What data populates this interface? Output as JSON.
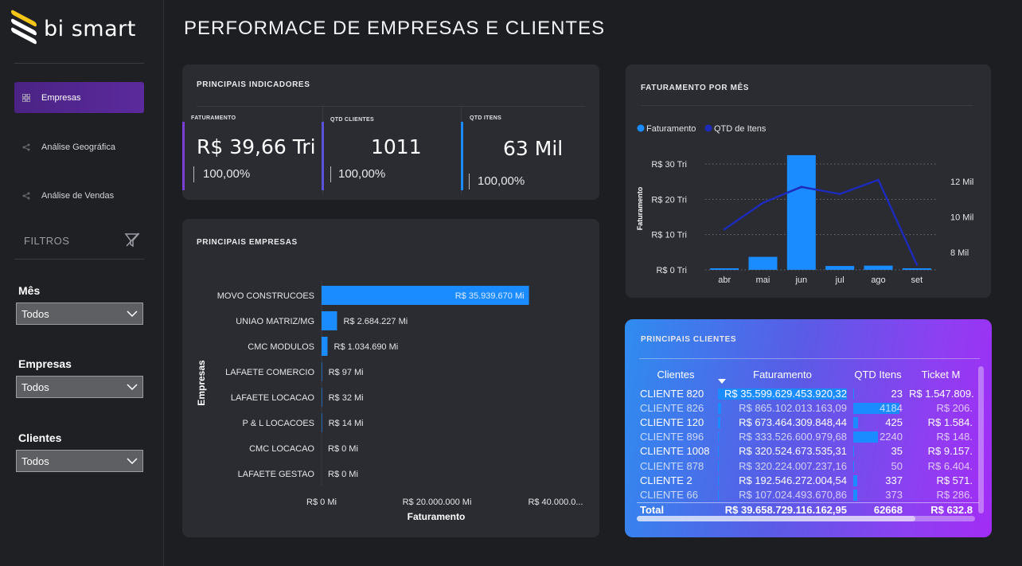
{
  "app": {
    "logo_text": "bi smart"
  },
  "page_title": "PERFORMACE DE EMPRESAS E CLIENTES",
  "nav": [
    {
      "label": "Empresas",
      "active": true,
      "icon": "grid-icon"
    },
    {
      "label": "Análise Geográfica",
      "active": false,
      "icon": "network-icon"
    },
    {
      "label": "Análise de Vendas",
      "active": false,
      "icon": "share-icon"
    }
  ],
  "filters": {
    "title": "FILTROS",
    "items": [
      {
        "label": "Mês",
        "value": "Todos"
      },
      {
        "label": "Empresas",
        "value": "Todos"
      },
      {
        "label": "Clientes",
        "value": "Todos"
      }
    ]
  },
  "kpis": {
    "title": "PRINCIPAIS INDICADORES",
    "items": [
      {
        "label": "FATURAMENTO",
        "value": "R$ 39,66 Tri",
        "pct": "100,00%",
        "color": "#7b3fd6"
      },
      {
        "label": "QTD CLIENTES",
        "value": "1011",
        "pct": "100,00%",
        "color": "#5a52d8"
      },
      {
        "label": "QTD ITENS",
        "value": "63 Mil",
        "pct": "100,00%",
        "color": "#1a8cff"
      }
    ]
  },
  "colors": {
    "accent": "#1a8cff",
    "line": "#1d2bb8",
    "purple": "#5b2a9c"
  },
  "chart_data": [
    {
      "type": "bar",
      "title": "PRINCIPAIS EMPRESAS",
      "orientation": "horizontal",
      "xlabel": "Faturamento",
      "ylabel": "Empresas",
      "categories": [
        "MOVO CONSTRUCOES",
        "UNIAO MATRIZ/MG",
        "CMC MODULOS",
        "LAFAETE COMERCIO",
        "LAFAETE LOCACAO",
        "P & L LOCACOES",
        "CMC LOCACAO",
        "LAFAETE GESTAO"
      ],
      "values": [
        35939670,
        2684227,
        1034690,
        97,
        32,
        14,
        0,
        0
      ],
      "value_labels": [
        "R$ 35.939.670 Mi",
        "R$ 2.684.227 Mi",
        "R$ 1.034.690 Mi",
        "R$ 97 Mi",
        "R$ 32 Mi",
        "R$ 14 Mi",
        "R$ 0 Mi",
        "R$ 0 Mi"
      ],
      "x_ticks": [
        "R$ 0 Mi",
        "R$ 20.000.000 Mi",
        "R$ 40.000.0..."
      ],
      "xlim": [
        0,
        40000000
      ]
    },
    {
      "type": "bar+line",
      "title": "FATURAMENTO POR MÊS",
      "legend": [
        "Faturamento",
        "QTD de Itens"
      ],
      "legend_position": "top-left",
      "categories": [
        "abr",
        "mai",
        "jun",
        "jul",
        "ago",
        "set"
      ],
      "series": [
        {
          "name": "Faturamento",
          "type": "bar",
          "values": [
            0.3,
            3.7,
            32.5,
            1.1,
            1.2,
            0.4
          ],
          "color": "#1a8cff"
        },
        {
          "name": "QTD de Itens",
          "type": "line",
          "values": [
            9.3,
            10.8,
            11.7,
            11.3,
            12.1,
            7.3
          ],
          "color": "#1d2bb8"
        }
      ],
      "ylabel": "Faturamento",
      "y_ticks": [
        "R$ 0 Tri",
        "R$ 10 Tri",
        "R$ 20 Tri",
        "R$ 30 Tri"
      ],
      "ylim": [
        0,
        30
      ],
      "y2_ticks": [
        "8 Mil",
        "10 Mil",
        "12 Mil"
      ],
      "y2lim": [
        7,
        13
      ]
    }
  ],
  "clients": {
    "title": "PRINCIPAIS CLIENTES",
    "columns": [
      "Clientes",
      "Faturamento",
      "QTD Itens",
      "Ticket M"
    ],
    "rows": [
      {
        "cliente": "CLIENTE 820",
        "fat": "R$ 35.599.629.453.920,32",
        "qtd": "23",
        "ticket": "R$ 1.547.809.",
        "fat_frac": 1.0,
        "qtd_frac": 0.005
      },
      {
        "cliente": "CLIENTE 826",
        "fat": "R$ 865.102.013.163,09",
        "qtd": "4184",
        "ticket": "R$ 206.",
        "fat_frac": 0.024,
        "qtd_frac": 1.0
      },
      {
        "cliente": "CLIENTE 120",
        "fat": "R$ 673.464.309.848,44",
        "qtd": "425",
        "ticket": "R$ 1.584.",
        "fat_frac": 0.019,
        "qtd_frac": 0.1
      },
      {
        "cliente": "CLIENTE 896",
        "fat": "R$ 333.526.600.979,68",
        "qtd": "2240",
        "ticket": "R$ 148.",
        "fat_frac": 0.009,
        "qtd_frac": 0.54
      },
      {
        "cliente": "CLIENTE 1008",
        "fat": "R$ 320.524.673.535,31",
        "qtd": "35",
        "ticket": "R$ 9.157.",
        "fat_frac": 0.009,
        "qtd_frac": 0.008
      },
      {
        "cliente": "CLIENTE 878",
        "fat": "R$ 320.224.007.237,16",
        "qtd": "50",
        "ticket": "R$ 6.404.",
        "fat_frac": 0.009,
        "qtd_frac": 0.012
      },
      {
        "cliente": "CLIENTE 2",
        "fat": "R$ 192.546.272.004,54",
        "qtd": "337",
        "ticket": "R$ 571.",
        "fat_frac": 0.005,
        "qtd_frac": 0.08
      },
      {
        "cliente": "CLIENTE 66",
        "fat": "R$ 107.024.493.670,86",
        "qtd": "373",
        "ticket": "R$ 286.",
        "fat_frac": 0.003,
        "qtd_frac": 0.09
      }
    ],
    "total": {
      "cliente": "Total",
      "fat": "R$ 39.658.729.116.162,95",
      "qtd": "62668",
      "ticket": "R$ 632.8"
    }
  }
}
